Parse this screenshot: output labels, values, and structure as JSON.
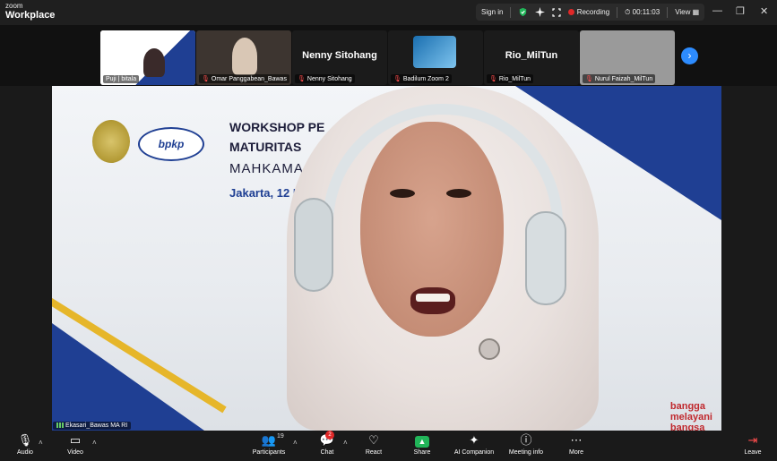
{
  "app": {
    "brand_top": "zoom",
    "brand_bottom": "Workplace"
  },
  "topbar": {
    "signin": "Sign in",
    "recording": "Recording",
    "timer": "00:11:03",
    "view": "View"
  },
  "window_controls": {
    "minimize": "—",
    "restore": "❐",
    "close": "✕"
  },
  "strip": {
    "tiles": [
      {
        "caption": "Puji | bitala",
        "type": "slide"
      },
      {
        "caption": "Omar Panggabean_Bawas",
        "type": "video"
      },
      {
        "caption": "Nenny Sitohang",
        "display_name": "Nenny Sitohang",
        "type": "name"
      },
      {
        "caption": "Badilum Zoom 2",
        "type": "video"
      },
      {
        "caption": "Rio_MilTun",
        "display_name": "Rio_MilTun",
        "type": "name"
      },
      {
        "caption": "Nurul Faizah_MilTun",
        "type": "video"
      }
    ],
    "next": "›"
  },
  "slide": {
    "logo_text": "bpkp",
    "title1": "WORKSHOP PE",
    "title2": "MATURITAS",
    "title3": "MAHKAMA",
    "date": "Jakarta, 12 M",
    "tagline": [
      "bangga",
      "melayani",
      "bangsa"
    ]
  },
  "main_caption": "Ekasari_Bawas MA RI",
  "toolbar": {
    "audio": "Audio",
    "video": "Video",
    "participants": "Participants",
    "participants_count": "19",
    "chat": "Chat",
    "chat_badge": "2",
    "react": "React",
    "share": "Share",
    "ai_companion": "AI Companion",
    "meeting_info": "Meeting info",
    "more": "More",
    "leave": "Leave"
  },
  "colors": {
    "accent": "#2d8cff",
    "share": "#21b559",
    "record": "#e02828",
    "navy": "#1f3f93",
    "gold": "#e6b62a"
  }
}
